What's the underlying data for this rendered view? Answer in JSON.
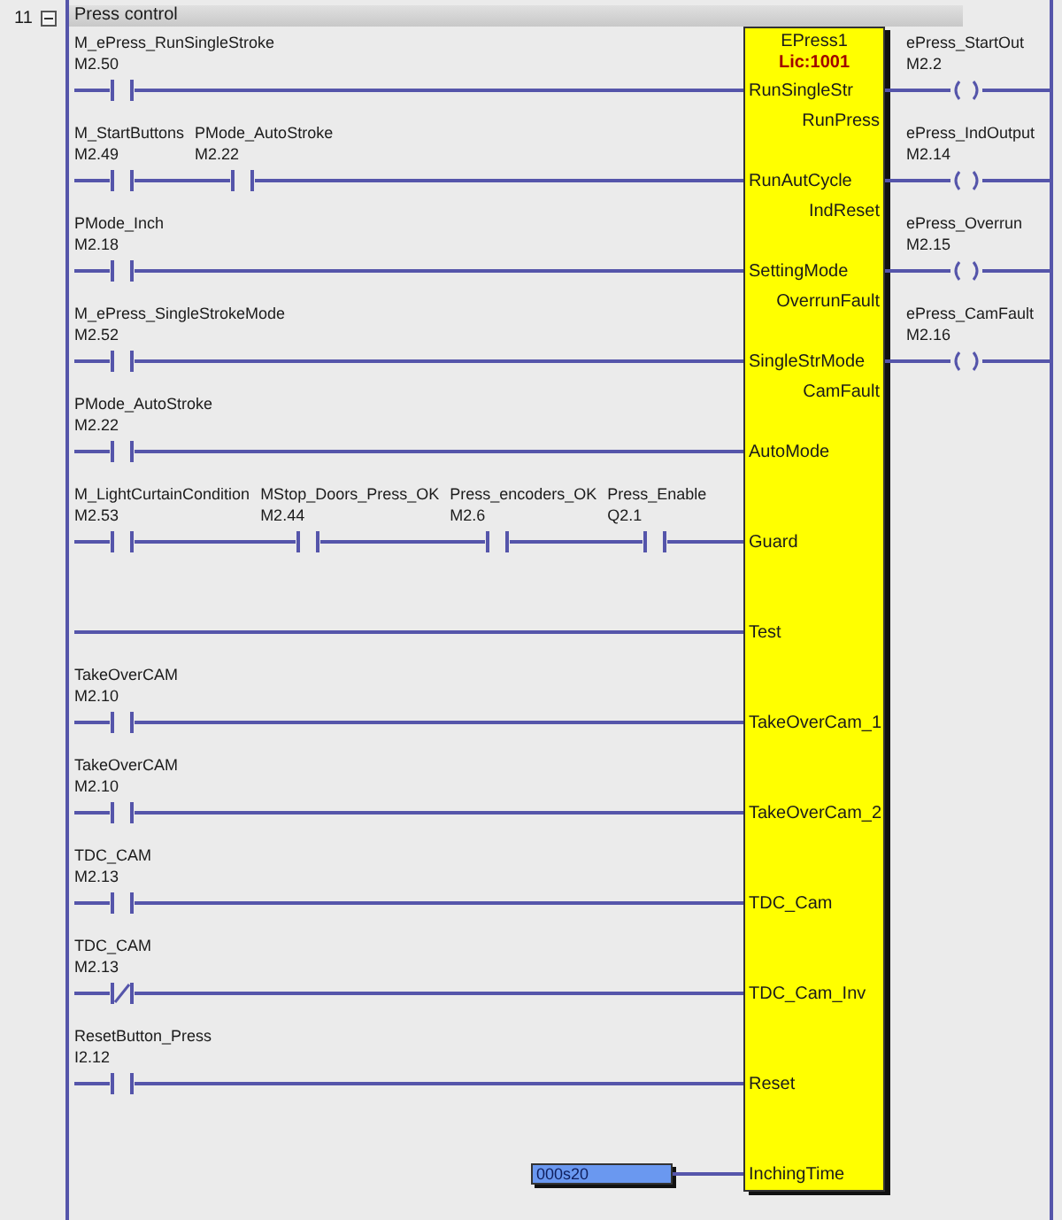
{
  "network": {
    "number": "11",
    "expanded": true,
    "title": "Press control"
  },
  "block": {
    "instance": "EPress1",
    "license": "Lic:1001"
  },
  "rungs": [
    {
      "pin": "RunSingleStr",
      "output_pin": "RunPress",
      "contacts": [
        {
          "tag": "M_ePress_RunSingleStroke",
          "address": "M2.50",
          "kind": "open"
        }
      ]
    },
    {
      "pin": "RunAutCycle",
      "output_pin": "IndReset",
      "contacts": [
        {
          "tag": "M_StartButtons",
          "address": "M2.49",
          "kind": "open"
        },
        {
          "tag": "PMode_AutoStroke",
          "address": "M2.22",
          "kind": "open"
        }
      ]
    },
    {
      "pin": "SettingMode",
      "output_pin": "OverrunFault",
      "contacts": [
        {
          "tag": "PMode_Inch",
          "address": "M2.18",
          "kind": "open"
        }
      ]
    },
    {
      "pin": "SingleStrMode",
      "output_pin": "CamFault",
      "contacts": [
        {
          "tag": "M_ePress_SingleStrokeMode",
          "address": "M2.52",
          "kind": "open"
        }
      ]
    },
    {
      "pin": "AutoMode",
      "contacts": [
        {
          "tag": "PMode_AutoStroke",
          "address": "M2.22",
          "kind": "open"
        }
      ]
    },
    {
      "pin": "Guard",
      "contacts": [
        {
          "tag": "M_LightCurtainCondition",
          "address": "M2.53",
          "kind": "open"
        },
        {
          "tag": "MStop_Doors_Press_OK",
          "address": "M2.44",
          "kind": "open"
        },
        {
          "tag": "Press_encoders_OK",
          "address": "M2.6",
          "kind": "open"
        },
        {
          "tag": "Press_Enable",
          "address": "Q2.1",
          "kind": "open"
        }
      ]
    },
    {
      "pin": "Test"
    },
    {
      "pin": "TakeOverCam_1",
      "contacts": [
        {
          "tag": "TakeOverCAM",
          "address": "M2.10",
          "kind": "open"
        }
      ]
    },
    {
      "pin": "TakeOverCam_2",
      "contacts": [
        {
          "tag": "TakeOverCAM",
          "address": "M2.10",
          "kind": "open"
        }
      ]
    },
    {
      "pin": "TDC_Cam",
      "contacts": [
        {
          "tag": "TDC_CAM",
          "address": "M2.13",
          "kind": "open"
        }
      ]
    },
    {
      "pin": "TDC_Cam_Inv",
      "contacts": [
        {
          "tag": "TDC_CAM",
          "address": "M2.13",
          "kind": "closed"
        }
      ]
    },
    {
      "pin": "Reset",
      "contacts": [
        {
          "tag": "ResetButton_Press",
          "address": "I2.12",
          "kind": "open"
        }
      ]
    },
    {
      "pin": "InchingTime",
      "constant": "000s20"
    }
  ],
  "outputs": [
    {
      "tag": "ePress_StartOut",
      "address": "M2.2"
    },
    {
      "tag": "ePress_IndOutput",
      "address": "M2.14"
    },
    {
      "tag": "ePress_Overrun",
      "address": "M2.15"
    },
    {
      "tag": "ePress_CamFault",
      "address": "M2.16"
    }
  ]
}
